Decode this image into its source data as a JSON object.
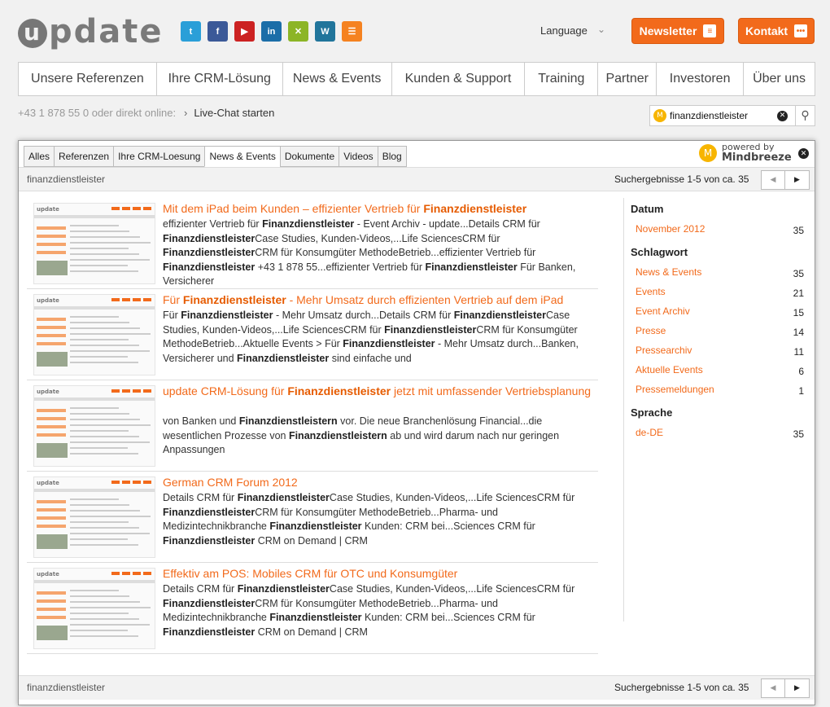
{
  "header": {
    "logo_initial": "u",
    "logo_rest": "pdate",
    "social": [
      {
        "name": "twitter-icon",
        "glyph": "t",
        "color": "#2a9fd8"
      },
      {
        "name": "facebook-icon",
        "glyph": "f",
        "color": "#3b5998"
      },
      {
        "name": "youtube-icon",
        "glyph": "▶",
        "color": "#cc2222"
      },
      {
        "name": "linkedin-icon",
        "glyph": "in",
        "color": "#1b6ea8"
      },
      {
        "name": "xing-icon",
        "glyph": "✕",
        "color": "#8cb526"
      },
      {
        "name": "wordpress-icon",
        "glyph": "W",
        "color": "#21759b"
      },
      {
        "name": "rss-icon",
        "glyph": "☰",
        "color": "#f58220"
      }
    ],
    "language_label": "Language",
    "newsletter_label": "Newsletter",
    "kontakt_label": "Kontakt",
    "accent": "#f26a1b"
  },
  "nav": [
    {
      "label": "Unsere Referenzen"
    },
    {
      "label": "Ihre CRM-Lösung"
    },
    {
      "label": "News & Events"
    },
    {
      "label": "Kunden & Support"
    },
    {
      "label": "Training"
    },
    {
      "label": "Partner"
    },
    {
      "label": "Investoren"
    },
    {
      "label": "Über uns"
    }
  ],
  "subbar": {
    "phone": "+43 1 878 55 0 oder direkt online:",
    "chat": "Live-Chat starten",
    "search_value": "finanzdienstleister"
  },
  "panel": {
    "tabs": [
      {
        "label": "Alles"
      },
      {
        "label": "Referenzen"
      },
      {
        "label": "Ihre CRM-Loesung"
      },
      {
        "label": "News & Events",
        "active": true
      },
      {
        "label": "Dokumente"
      },
      {
        "label": "Videos"
      },
      {
        "label": "Blog"
      }
    ],
    "powered_by": "powered by",
    "powered_brand": "Mindbreeze",
    "query": "finanzdienstleister",
    "result_count": "Suchergebnisse 1-5 von ca. 35",
    "results": [
      {
        "title_html": "Mit dem iPad beim Kunden – effizienter Vertrieb für <b>Finanzdienstleister</b>",
        "snippet_html": "effizienter Vertrieb für <b>Finanzdienstleister</b> - Event Archiv - update...Details CRM für <b>Finanzdienstleister</b>Case Studies, Kunden-Videos,...Life SciencesCRM für <b>Finanzdienstleister</b>CRM für Konsumgüter MethodeBetrieb...effizienter Vertrieb für <b>Finanzdienstleister</b> +43 1 878 55...effizienter Vertrieb für <b>Finanzdienstleister</b> Für Banken, Versicherer"
      },
      {
        "title_html": "Für <b>Finanzdienstleister</b> - Mehr Umsatz durch effizienten Vertrieb auf dem iPad",
        "snippet_html": "Für <b>Finanzdienstleister</b> - Mehr Umsatz durch...Details CRM für <b>Finanzdienstleister</b>Case Studies, Kunden-Videos,...Life SciencesCRM für <b>Finanzdienstleister</b>CRM für Konsumgüter MethodeBetrieb...Aktuelle Events > Für <b>Finanzdienstleister</b> - Mehr Umsatz durch...Banken, Versicherer und <b>Finanzdienstleister</b> sind einfache und"
      },
      {
        "title_html": "update CRM-Lösung für <b>Finanzdienstleister</b> jetzt mit umfassender Vertriebsplanung",
        "snippet_html": "von Banken und <b>Finanzdienstleistern</b> vor. Die neue Branchenlösung Financial...die wesentlichen Prozesse von <b>Finanzdienstleistern</b> ab und wird darum nach nur geringen Anpassungen"
      },
      {
        "title_html": "German CRM Forum 2012",
        "snippet_html": "Details CRM für <b>Finanzdienstleister</b>Case Studies, Kunden-Videos,...Life SciencesCRM für <b>Finanzdienstleister</b>CRM für Konsumgüter MethodeBetrieb...Pharma- und Medizintechnikbranche <b>Finanzdienstleister</b> Kunden: CRM bei...Sciences CRM für <b>Finanzdienstleister</b> CRM on Demand | CRM"
      },
      {
        "title_html": "Effektiv am POS: Mobiles CRM für OTC und Konsumgüter",
        "snippet_html": "Details CRM für <b>Finanzdienstleister</b>Case Studies, Kunden-Videos,...Life SciencesCRM für <b>Finanzdienstleister</b>CRM für Konsumgüter MethodeBetrieb...Pharma- und Medizintechnikbranche <b>Finanzdienstleister</b> Kunden: CRM bei...Sciences CRM für <b>Finanzdienstleister</b> CRM on Demand | CRM"
      }
    ],
    "facets": [
      {
        "heading": "Datum",
        "items": [
          {
            "label": "November 2012",
            "count": "35"
          }
        ]
      },
      {
        "heading": "Schlagwort",
        "items": [
          {
            "label": "News & Events",
            "count": "35"
          },
          {
            "label": "Events",
            "count": "21"
          },
          {
            "label": "Event Archiv",
            "count": "15"
          },
          {
            "label": "Presse",
            "count": "14"
          },
          {
            "label": "Pressearchiv",
            "count": "11"
          },
          {
            "label": "Aktuelle Events",
            "count": "6"
          },
          {
            "label": "Pressemeldungen",
            "count": "1"
          }
        ]
      },
      {
        "heading": "Sprache",
        "items": [
          {
            "label": "de-DE",
            "count": "35"
          }
        ]
      }
    ]
  }
}
